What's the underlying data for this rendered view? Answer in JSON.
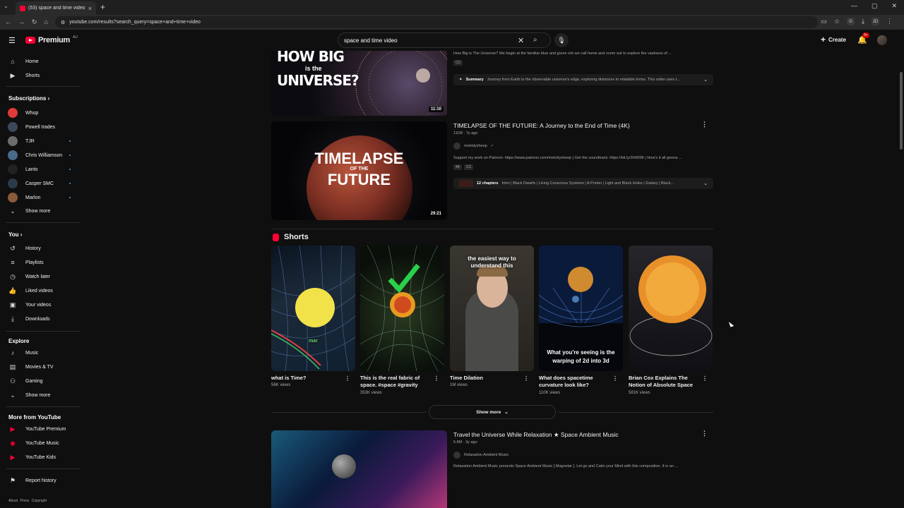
{
  "browser": {
    "tab_title": "(53) space and time video - YouTube",
    "url": "youtube.com/results?search_query=space+and+time+video",
    "profile_initials": "JD"
  },
  "header": {
    "logo_text": "Premium",
    "logo_region": "AU",
    "search_value": "space and time video",
    "create_label": "Create",
    "notif_badge": "9+"
  },
  "sidebar": {
    "main": [
      {
        "label": "Home",
        "icon": "home-icon"
      },
      {
        "label": "Shorts",
        "icon": "shorts-icon"
      }
    ],
    "subscriptions_title": "Subscriptions",
    "subscriptions": [
      {
        "label": "Whop",
        "color": "#e03a3a",
        "dot": false
      },
      {
        "label": "Powell trades",
        "color": "#3a4a5a",
        "dot": false
      },
      {
        "label": "TJR",
        "color": "#6c6c6c",
        "dot": true
      },
      {
        "label": "Chris Williamson",
        "color": "#4a6a8a",
        "dot": true
      },
      {
        "label": "Lanto",
        "color": "#222222",
        "dot": true
      },
      {
        "label": "Casper SMC",
        "color": "#2b3b4b",
        "dot": true
      },
      {
        "label": "Marlon",
        "color": "#8a5a3a",
        "dot": true
      }
    ],
    "subs_show_more": "Show more",
    "you_title": "You",
    "you": [
      {
        "label": "History",
        "icon": "history-icon"
      },
      {
        "label": "Playlists",
        "icon": "playlists-icon"
      },
      {
        "label": "Watch later",
        "icon": "watch-later-icon"
      },
      {
        "label": "Liked videos",
        "icon": "thumbs-up-icon"
      },
      {
        "label": "Your videos",
        "icon": "your-videos-icon"
      },
      {
        "label": "Downloads",
        "icon": "download-icon"
      }
    ],
    "explore_title": "Explore",
    "explore": [
      {
        "label": "Music",
        "icon": "music-icon"
      },
      {
        "label": "Movies & TV",
        "icon": "movies-icon"
      },
      {
        "label": "Gaming",
        "icon": "gaming-icon"
      }
    ],
    "explore_show_more": "Show more",
    "more_title": "More from YouTube",
    "more": [
      {
        "label": "YouTube Premium"
      },
      {
        "label": "YouTube Music"
      },
      {
        "label": "YouTube Kids"
      }
    ],
    "report": "Report history",
    "footer": "About  Press  Copyright"
  },
  "videos": [
    {
      "thumb_text_1": "HOW BIG",
      "thumb_text_2": "is the",
      "thumb_text_3": "UNIVERSE?",
      "duration": "11:10",
      "description": "How Big is The Universe? We begin at the familiar blue and green orb we call home and zoom out to explore the vastness of ...",
      "chip": "CC",
      "summary_label": "Summary",
      "summary_text": "Journey from Earth to the observable universe's edge, exploring distances in relatable terms. This video uses t..."
    },
    {
      "title": "TIMELAPSE OF THE FUTURE: A Journey to the End of Time (4K)",
      "meta": "111M · 7y ago",
      "channel": "melodysheep",
      "thumb_text_1": "TIMELAPSE",
      "thumb_text_2": "OF THE",
      "thumb_text_3": "FUTURE",
      "duration": "29:21",
      "description": "Support my work on Patreon: https://www.patreon.com/melodysheep | Get the soundtrack: https://bit.ly/2H9096 | How's it all gonna ...",
      "chips": [
        "4K",
        "CC"
      ],
      "chapters_label": "12 chapters",
      "chapters_text": "Intro | Black Dwarfs | Living Conscious Systems | A Proton | Light and Black Holes | Galaxy | Black..."
    },
    {
      "title": "Travel the Universe While Relaxation ★ Space Ambient Music",
      "meta": "5.8M · 3y ago",
      "channel": "Relaxation Ambient Music",
      "description": "Relaxation Ambient Music presents Space Ambient Music [ Magnetar ]. Let go and Calm your Mind with this composition. It is an ..."
    }
  ],
  "shorts": {
    "title": "Shorts",
    "show_more": "Show more",
    "items": [
      {
        "title": "what is Time?",
        "views": "56K views",
        "overlay": "mar"
      },
      {
        "title": "This is the real fabric of space. #space #gravity",
        "views": "353K views"
      },
      {
        "title": "Time Dilation",
        "views": "1M views",
        "overlay": "the easiest way to understand this"
      },
      {
        "title": "What does spacetime curvature look like?",
        "views": "110K views",
        "overlay": "What you're seeing is the warping of 2d into 3d"
      },
      {
        "title": "Brian Cox Explains The Notion of Absolute Space",
        "views": "581K views"
      }
    ]
  }
}
